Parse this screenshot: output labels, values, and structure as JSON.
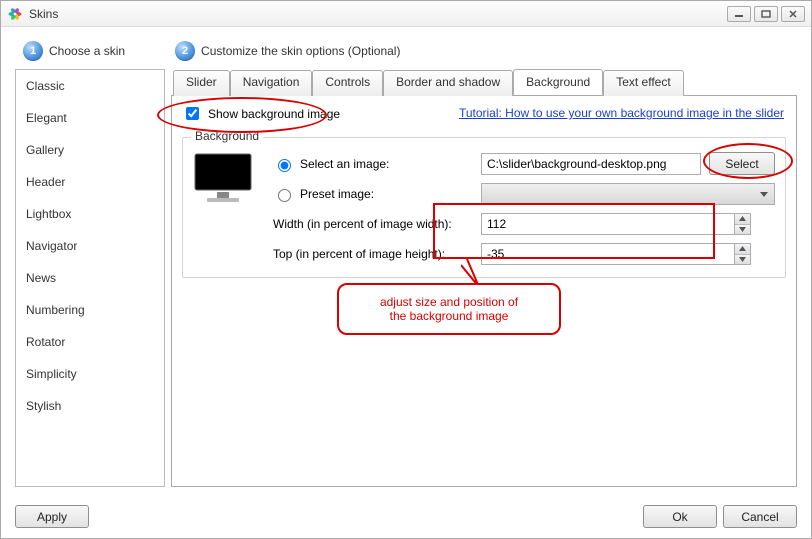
{
  "window": {
    "title": "Skins"
  },
  "steps": {
    "one_num": "1",
    "one_label": "Choose a skin",
    "two_num": "2",
    "two_label": "Customize the skin options (Optional)"
  },
  "sidebar": {
    "items": [
      {
        "label": "Classic"
      },
      {
        "label": "Elegant"
      },
      {
        "label": "Gallery"
      },
      {
        "label": "Header"
      },
      {
        "label": "Lightbox"
      },
      {
        "label": "Navigator"
      },
      {
        "label": "News"
      },
      {
        "label": "Numbering"
      },
      {
        "label": "Rotator"
      },
      {
        "label": "Simplicity"
      },
      {
        "label": "Stylish"
      }
    ]
  },
  "tabs": [
    {
      "label": "Slider"
    },
    {
      "label": "Navigation"
    },
    {
      "label": "Controls"
    },
    {
      "label": "Border and shadow"
    },
    {
      "label": "Background"
    },
    {
      "label": "Text effect"
    }
  ],
  "panel": {
    "show_bg_label": "Show background image",
    "tutorial_link": "Tutorial: How to use your own background image in the slider",
    "group_caption": "Background",
    "radio_select": "Select an image:",
    "radio_preset": "Preset image:",
    "image_path": "C:\\slider\\background-desktop.png",
    "select_btn": "Select",
    "width_label": "Width (in percent of image width):",
    "top_label": "Top (in percent of image height):",
    "width_value": "112",
    "top_value": "-35"
  },
  "annotations": {
    "callout_line1": "adjust size and position of",
    "callout_line2": "the background image"
  },
  "footer": {
    "apply": "Apply",
    "ok": "Ok",
    "cancel": "Cancel"
  }
}
